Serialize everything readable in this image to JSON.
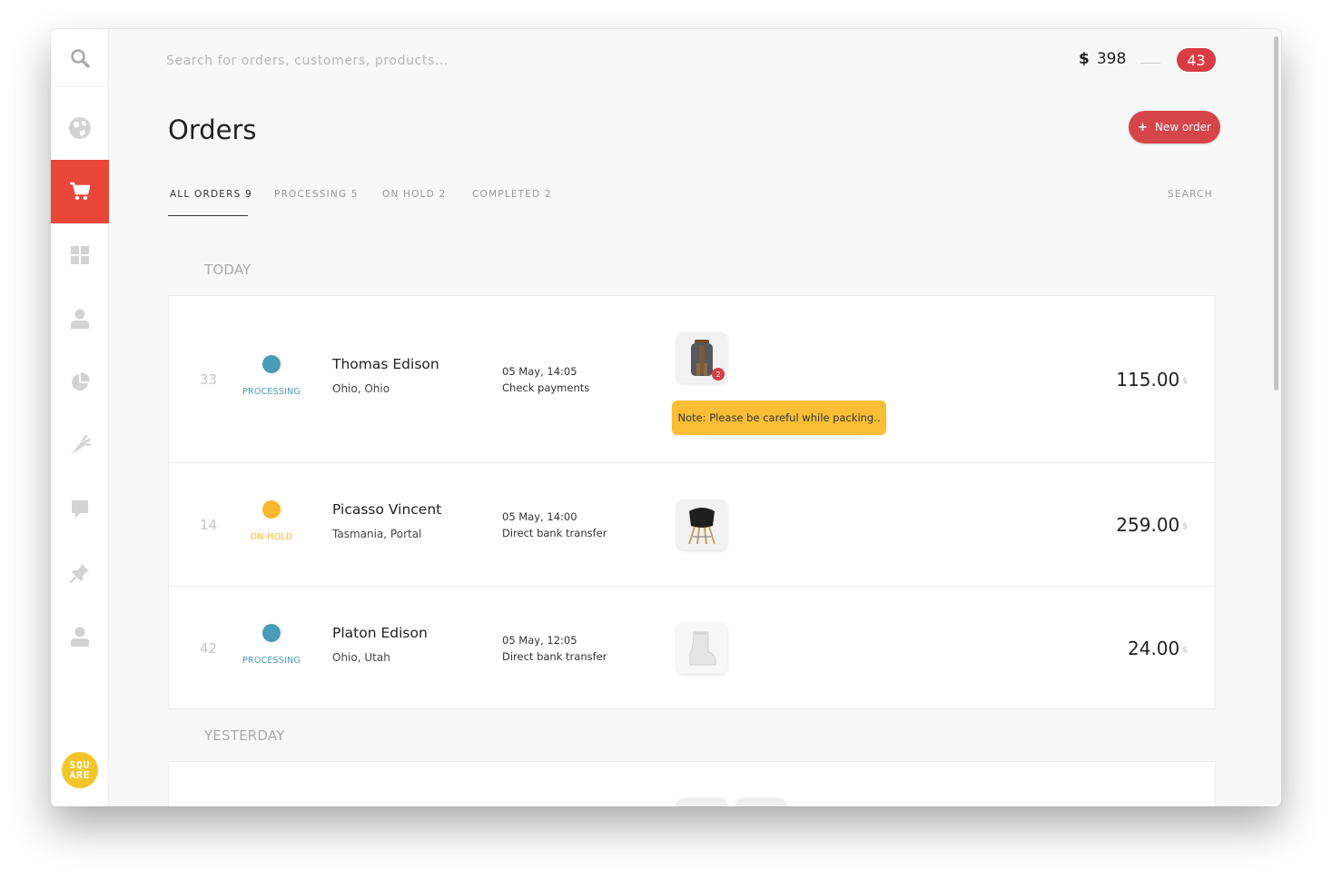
{
  "search": {
    "placeholder": "Search for orders, customers, products..."
  },
  "header": {
    "currency": "$",
    "balance": "398",
    "count": "43"
  },
  "page": {
    "title": "Orders",
    "new_order_plus": "+",
    "new_order_label": "New order"
  },
  "tabs": [
    {
      "label": "ALL ORDERS 9",
      "active": true
    },
    {
      "label": "PROCESSING 5",
      "active": false
    },
    {
      "label": "ON HOLD 2",
      "active": false
    },
    {
      "label": "COMPLETED 2",
      "active": false
    }
  ],
  "tab_search": "SEARCH",
  "groups": [
    {
      "label": "TODAY",
      "orders": [
        {
          "number": "33",
          "status": "PROCESSING",
          "status_color": "#4a9bb5",
          "name": "Thomas Edison",
          "location": "Ohio, Ohio",
          "date": "05 May, 14:05",
          "payment": "Check payments",
          "product_icon": "backpack-icon",
          "product_count": "2",
          "note": "Note: Please be careful while packing..",
          "amount": "115.00",
          "currency": "$"
        },
        {
          "number": "14",
          "status": "ON-HOLD",
          "status_color": "#f5b92a",
          "name": "Picasso Vincent",
          "location": "Tasmania, Portal",
          "date": "05 May, 14:00",
          "payment": "Direct bank transfer",
          "product_icon": "chair-icon",
          "amount": "259.00",
          "currency": "$"
        },
        {
          "number": "42",
          "status": "PROCESSING",
          "status_color": "#4a9bb5",
          "name": "Platon Edison",
          "location": "Ohio, Utah",
          "date": "05 May, 12:05",
          "payment": "Direct bank transfer",
          "product_icon": "boot-icon",
          "amount": "24.00",
          "currency": "$"
        }
      ]
    },
    {
      "label": "YESTERDAY",
      "orders": []
    }
  ],
  "logo": {
    "text": "SQU\nARE",
    "color": "#f3c52b"
  },
  "colors": {
    "accent": "#e8473a",
    "badge": "#d83d42",
    "note": "#f9be35"
  }
}
